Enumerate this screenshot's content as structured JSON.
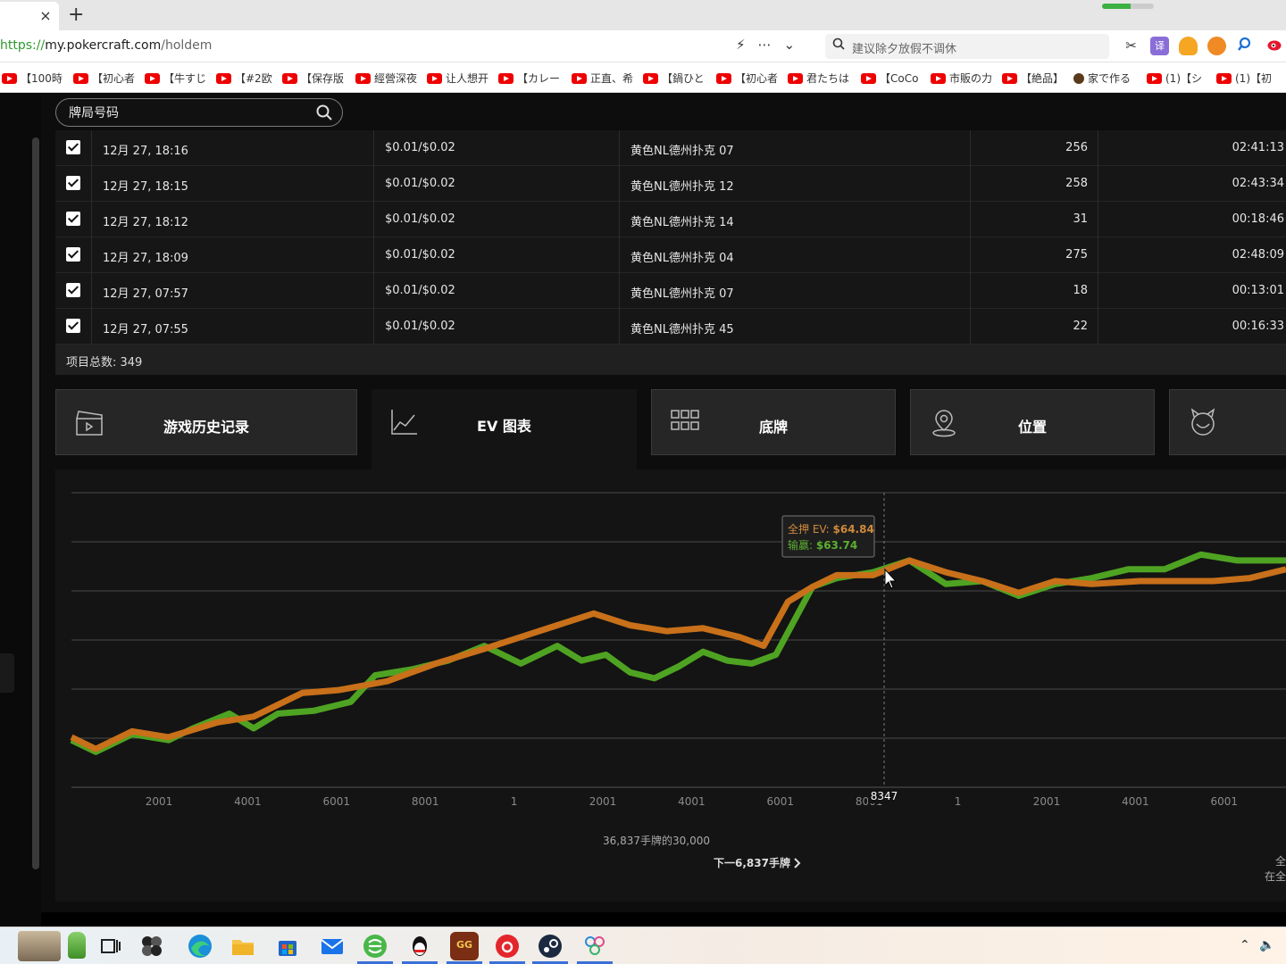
{
  "browser": {
    "tab_close": "×",
    "new_tab": "+",
    "extension_progress": 0.55,
    "url": {
      "scheme": "https://",
      "host": "my.pokercraft.com",
      "path": "/holdem"
    },
    "search_placeholder": "建议除夕放假不调休",
    "right_icon_labels": [
      "✂",
      "译",
      "",
      "",
      "",
      ""
    ]
  },
  "bookmarks": [
    {
      "label": "【100時",
      "yt": true
    },
    {
      "label": "【初心者",
      "yt": true
    },
    {
      "label": "【牛すじ",
      "yt": true
    },
    {
      "label": "【#2欧",
      "yt": true
    },
    {
      "label": "【保存版",
      "yt": true
    },
    {
      "label": "經營深夜",
      "yt": true
    },
    {
      "label": "让人想开",
      "yt": true
    },
    {
      "label": "【カレー",
      "yt": true
    },
    {
      "label": "正直、希",
      "yt": true
    },
    {
      "label": "【鍋ひと",
      "yt": true
    },
    {
      "label": "【初心者",
      "yt": true
    },
    {
      "label": "君たちは",
      "yt": true
    },
    {
      "label": "【CoCo",
      "yt": true
    },
    {
      "label": "市販の力",
      "yt": true
    },
    {
      "label": "【絶品】",
      "yt": true
    },
    {
      "label": "家で作る",
      "yt": false
    },
    {
      "label": "(1)【シ",
      "yt": true
    },
    {
      "label": "(1)【初",
      "yt": true
    }
  ],
  "hand_search": {
    "placeholder": "牌局号码"
  },
  "table": {
    "rows": [
      {
        "date": "12月 27, 18:16",
        "stakes": "$0.01/$0.02",
        "table": "黄色NL德州扑克 07",
        "hands": "256",
        "duration": "02:41:13"
      },
      {
        "date": "12月 27, 18:15",
        "stakes": "$0.01/$0.02",
        "table": "黄色NL德州扑克 12",
        "hands": "258",
        "duration": "02:43:34"
      },
      {
        "date": "12月 27, 18:12",
        "stakes": "$0.01/$0.02",
        "table": "黄色NL德州扑克 14",
        "hands": "31",
        "duration": "00:18:46"
      },
      {
        "date": "12月 27, 18:09",
        "stakes": "$0.01/$0.02",
        "table": "黄色NL德州扑克 04",
        "hands": "275",
        "duration": "02:48:09"
      },
      {
        "date": "12月 27, 07:57",
        "stakes": "$0.01/$0.02",
        "table": "黄色NL德州扑克 07",
        "hands": "18",
        "duration": "00:13:01"
      },
      {
        "date": "12月 27, 07:55",
        "stakes": "$0.01/$0.02",
        "table": "黄色NL德州扑克 45",
        "hands": "22",
        "duration": "00:16:33"
      }
    ],
    "total": "项目总数: 349"
  },
  "tabs": [
    {
      "label": "游戏历史记录",
      "icon": "clapperboard-icon"
    },
    {
      "label": "EV 图表",
      "icon": "chart-icon",
      "active": true
    },
    {
      "label": "底牌",
      "icon": "grid-icon"
    },
    {
      "label": "位置",
      "icon": "location-icon"
    },
    {
      "label": "",
      "icon": "devil-icon"
    }
  ],
  "colors": {
    "allin_ev": "#c8701a",
    "winnings": "#4fa322",
    "tooltip_allin_text": "#d08a3c",
    "tooltip_win_text": "#5cb030"
  },
  "chart_data": {
    "type": "line",
    "x_tick_labels": [
      "2001",
      "4001",
      "6001",
      "8001",
      "1",
      "2001",
      "4001",
      "6001",
      "8001",
      "1",
      "2001",
      "4001",
      "6001"
    ],
    "crosshair_label": "8347",
    "series": [
      {
        "name": "全押 EV",
        "color": "#c8701a"
      },
      {
        "name": "输赢",
        "color": "#4fa322"
      }
    ],
    "series_points_frac": {
      "allin_ev": [
        [
          0,
          0.17
        ],
        [
          0.02,
          0.13
        ],
        [
          0.05,
          0.19
        ],
        [
          0.08,
          0.17
        ],
        [
          0.12,
          0.22
        ],
        [
          0.15,
          0.24
        ],
        [
          0.19,
          0.32
        ],
        [
          0.22,
          0.33
        ],
        [
          0.26,
          0.36
        ],
        [
          0.3,
          0.42
        ],
        [
          0.34,
          0.47
        ],
        [
          0.37,
          0.51
        ],
        [
          0.4,
          0.55
        ],
        [
          0.43,
          0.59
        ],
        [
          0.46,
          0.55
        ],
        [
          0.49,
          0.53
        ],
        [
          0.52,
          0.54
        ],
        [
          0.55,
          0.51
        ],
        [
          0.57,
          0.48
        ],
        [
          0.59,
          0.63
        ],
        [
          0.61,
          0.68
        ],
        [
          0.63,
          0.72
        ],
        [
          0.66,
          0.72
        ],
        [
          0.69,
          0.77
        ],
        [
          0.72,
          0.73
        ],
        [
          0.75,
          0.7
        ],
        [
          0.78,
          0.66
        ],
        [
          0.81,
          0.7
        ],
        [
          0.84,
          0.69
        ],
        [
          0.88,
          0.7
        ],
        [
          0.91,
          0.7
        ],
        [
          0.94,
          0.7
        ],
        [
          0.97,
          0.71
        ],
        [
          1,
          0.74
        ]
      ],
      "winnings": [
        [
          0,
          0.16
        ],
        [
          0.02,
          0.12
        ],
        [
          0.05,
          0.18
        ],
        [
          0.08,
          0.16
        ],
        [
          0.1,
          0.2
        ],
        [
          0.13,
          0.25
        ],
        [
          0.15,
          0.2
        ],
        [
          0.17,
          0.25
        ],
        [
          0.2,
          0.26
        ],
        [
          0.23,
          0.29
        ],
        [
          0.25,
          0.38
        ],
        [
          0.28,
          0.4
        ],
        [
          0.31,
          0.43
        ],
        [
          0.34,
          0.48
        ],
        [
          0.37,
          0.42
        ],
        [
          0.4,
          0.48
        ],
        [
          0.42,
          0.43
        ],
        [
          0.44,
          0.45
        ],
        [
          0.46,
          0.39
        ],
        [
          0.48,
          0.37
        ],
        [
          0.5,
          0.41
        ],
        [
          0.52,
          0.46
        ],
        [
          0.54,
          0.43
        ],
        [
          0.56,
          0.42
        ],
        [
          0.58,
          0.45
        ],
        [
          0.61,
          0.68
        ],
        [
          0.63,
          0.71
        ],
        [
          0.66,
          0.73
        ],
        [
          0.69,
          0.77
        ],
        [
          0.72,
          0.69
        ],
        [
          0.75,
          0.7
        ],
        [
          0.78,
          0.65
        ],
        [
          0.81,
          0.69
        ],
        [
          0.84,
          0.71
        ],
        [
          0.87,
          0.74
        ],
        [
          0.9,
          0.74
        ],
        [
          0.93,
          0.79
        ],
        [
          0.96,
          0.77
        ],
        [
          1,
          0.77
        ]
      ]
    },
    "tooltip": {
      "allin_label": "全押 EV: ",
      "allin_value": "$64.84",
      "win_label": "输赢: ",
      "win_value": "$63.74"
    },
    "grid": true,
    "range_text": "36,837手牌的30,000",
    "next_text": "下一6,837手牌",
    "right_cut_text": [
      "全",
      "在全"
    ]
  }
}
